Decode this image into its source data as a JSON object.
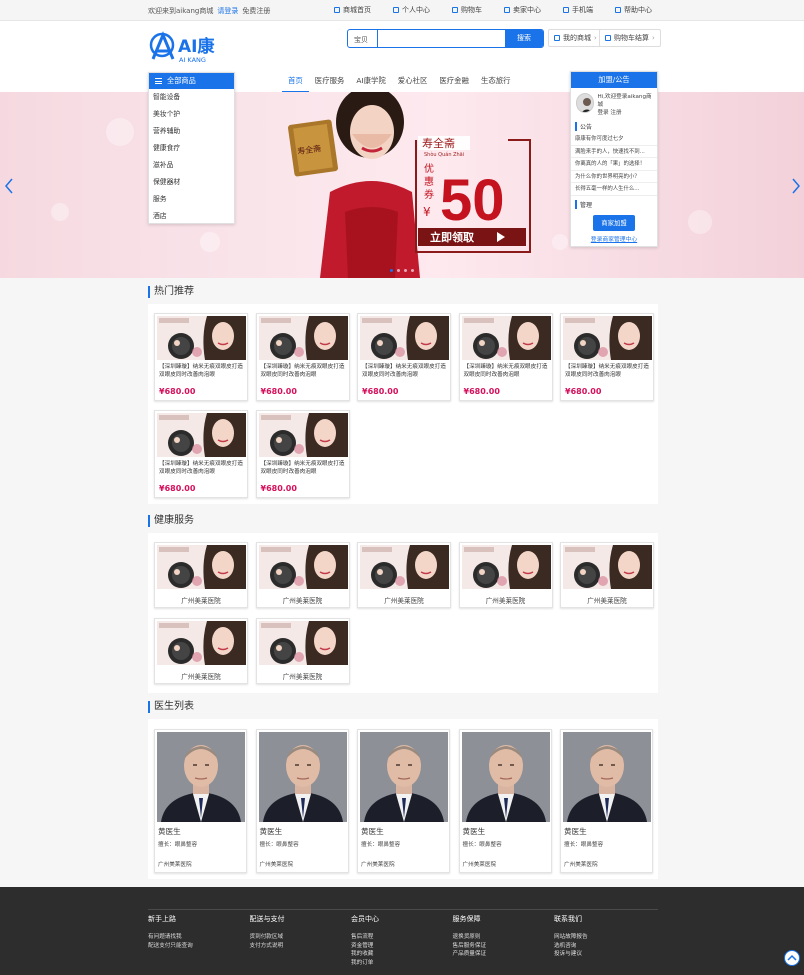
{
  "topbar": {
    "welcome": "欢迎来到aikang商城",
    "login": "请登录",
    "register": "免费注册",
    "links": [
      {
        "label": "商城首页",
        "icon": "home-icon"
      },
      {
        "label": "个人中心",
        "icon": "user-icon"
      },
      {
        "label": "购物车",
        "icon": "cart-icon"
      },
      {
        "label": "卖家中心",
        "icon": "shop-icon"
      },
      {
        "label": "手机端",
        "icon": "mobile-icon"
      },
      {
        "label": "帮助中心",
        "icon": "help-icon"
      }
    ]
  },
  "header": {
    "logo_text": "AI康",
    "logo_sub": "AI KANG",
    "search_category": "宝贝",
    "search_placeholder": "",
    "search_button": "搜索",
    "my_mall": "我的商城",
    "cart_checkout": "购物车结算"
  },
  "nav": [
    "首页",
    "医疗服务",
    "AI康学院",
    "爱心社区",
    "医疗金融",
    "生态旅行"
  ],
  "categories": {
    "title": "全部商品",
    "items": [
      "智能设备",
      "美妆个护",
      "营养辅助",
      "健康食疗",
      "滋补品",
      "保健器材",
      "服务",
      "酒店"
    ]
  },
  "banner": {
    "box_label": "寿全斋",
    "box_sub": "Shòu Quán Zhāi",
    "coupon_label": "优惠券",
    "coupon_currency": "¥",
    "coupon_value": "50",
    "coupon_action": "立即领取"
  },
  "notice": {
    "title": "加盟/公告",
    "greeting": "Hi,欢迎登录aikang商城",
    "login": "登录",
    "register": "注册",
    "notice_section": "公告",
    "lines": [
      "康康有你可度过七夕",
      "满脸来手的人，快速找不到...",
      "你离真的人的「果」的选择！",
      "为什么你的世界明亮的小？",
      "长得五毫一样的人生什么..."
    ],
    "manage_section": "管理",
    "join_button": "商家加盟",
    "manage_link": "登录商家管理中心"
  },
  "hot": {
    "title": "热门推荐",
    "items": [
      {
        "desc": "【深圳臻璇】纳米无痕双眼皮打造双眼皮同时改善肉泡眼",
        "price": "¥680.00"
      },
      {
        "desc": "【深圳臻璇】纳米无痕双眼皮打造双眼皮同时改善肉泡眼",
        "price": "¥680.00"
      },
      {
        "desc": "【深圳臻璇】纳米无痕双眼皮打造双眼皮同时改善肉泡眼",
        "price": "¥680.00"
      },
      {
        "desc": "【深圳臻璇】纳米无痕双眼皮打造双眼皮同时改善肉泡眼",
        "price": "¥680.00"
      },
      {
        "desc": "【深圳臻璇】纳米无痕双眼皮打造双眼皮同时改善肉泡眼",
        "price": "¥680.00"
      },
      {
        "desc": "【深圳臻璇】纳米无痕双眼皮打造双眼皮同时改善肉泡眼",
        "price": "¥680.00"
      },
      {
        "desc": "【深圳臻璇】纳米无痕双眼皮打造双眼皮同时改善肉泡眼",
        "price": "¥680.00"
      }
    ]
  },
  "health": {
    "title": "健康服务",
    "items": [
      "广州美莱医院",
      "广州美莱医院",
      "广州美莱医院",
      "广州美莱医院",
      "广州美莱医院",
      "广州美莱医院",
      "广州美莱医院"
    ]
  },
  "doctors": {
    "title": "医生列表",
    "items": [
      {
        "name": "黄医生",
        "spec": "擅长：眼鼻整容",
        "hospital": "广州美莱医院"
      },
      {
        "name": "黄医生",
        "spec": "擅长：眼鼻整容",
        "hospital": "广州美莱医院"
      },
      {
        "name": "黄医生",
        "spec": "擅长：眼鼻整容",
        "hospital": "广州美莱医院"
      },
      {
        "name": "黄医生",
        "spec": "擅长：眼鼻整容",
        "hospital": "广州美莱医院"
      },
      {
        "name": "黄医生",
        "spec": "擅长：眼鼻整容",
        "hospital": "广州美莱医院"
      }
    ]
  },
  "footer": {
    "cols": [
      {
        "title": "新手上路",
        "links": [
          "有问题请找我",
          "配送支付只能查询"
        ]
      },
      {
        "title": "配送与支付",
        "links": [
          "货到付款区域",
          "支付方式说明"
        ]
      },
      {
        "title": "会员中心",
        "links": [
          "售后流程",
          "资金管理",
          "我的收藏",
          "我的订单"
        ]
      },
      {
        "title": "服务保障",
        "links": [
          "退换货原则",
          "售后服务保证",
          "产品质量保证"
        ]
      },
      {
        "title": "联系我们",
        "links": [
          "网站故障报告",
          "选机咨询",
          "投诉与建议"
        ]
      }
    ]
  },
  "colors": {
    "accent": "#1a73e8",
    "price": "#d6105c",
    "footer": "#2d2d2d"
  }
}
